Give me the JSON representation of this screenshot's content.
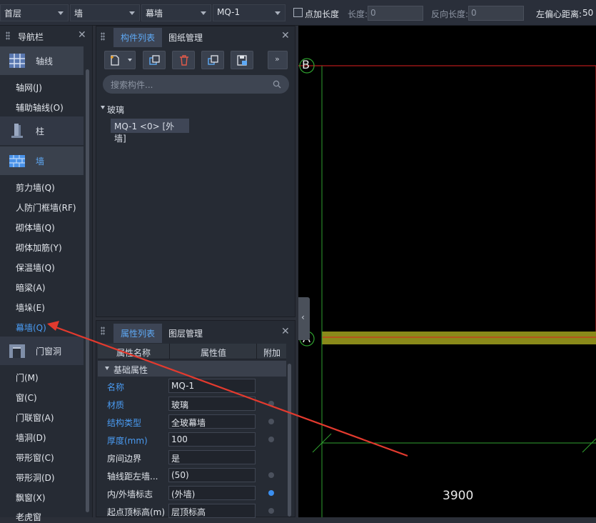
{
  "toolbar": {
    "floor": "首层",
    "category": "墙",
    "type": "幕墙",
    "component": "MQ-1",
    "add_point_length_label": "点加长度",
    "length_label": "长度:",
    "length_value": "0",
    "reverse_length_label": "反向长度:",
    "reverse_length_value": "0",
    "left_offset_label": "左偏心距离:",
    "left_offset_value": "50"
  },
  "nav": {
    "title": "导航栏",
    "categories": [
      {
        "label": "轴线",
        "icon": "grid-icon",
        "items": [
          "轴网(J)",
          "辅助轴线(O)"
        ]
      },
      {
        "label": "柱",
        "icon": "column-icon",
        "items": []
      },
      {
        "label": "墙",
        "icon": "wall-icon",
        "items": [
          "剪力墙(Q)",
          "人防门框墙(RF)",
          "砌体墙(Q)",
          "砌体加筋(Y)",
          "保温墙(Q)",
          "暗梁(A)",
          "墙垛(E)",
          "幕墙(Q)"
        ]
      },
      {
        "label": "门窗洞",
        "icon": "door-window-icon",
        "items": [
          "门(M)",
          "窗(C)",
          "门联窗(A)",
          "墙洞(D)",
          "带形窗(C)",
          "带形洞(D)",
          "飘窗(X)",
          "老虎窗"
        ]
      }
    ]
  },
  "component_panel": {
    "tabs": [
      "构件列表",
      "图纸管理"
    ],
    "search_placeholder": "搜索构件...",
    "tree_group": "玻璃",
    "tree_item": "MQ-1 <0> [外墙]"
  },
  "property_panel": {
    "tabs": [
      "属性列表",
      "图层管理"
    ],
    "columns": [
      "属性名称",
      "属性值",
      "附加"
    ],
    "group": "基础属性",
    "rows": [
      {
        "name": "名称",
        "value": "MQ-1",
        "blue": true,
        "dot": ""
      },
      {
        "name": "材质",
        "value": "玻璃",
        "blue": true,
        "dot": "gray"
      },
      {
        "name": "结构类型",
        "value": "全玻幕墙",
        "blue": true,
        "dot": "gray"
      },
      {
        "name": "厚度(mm)",
        "value": "100",
        "blue": true,
        "dot": "gray"
      },
      {
        "name": "房间边界",
        "value": "是",
        "blue": false,
        "dot": ""
      },
      {
        "name": "轴线距左墙...",
        "value": "(50)",
        "blue": false,
        "dot": "gray"
      },
      {
        "name": "内/外墙标志",
        "value": "(外墙)",
        "blue": false,
        "dot": "blue"
      },
      {
        "name": "起点顶标高(m)",
        "value": "层顶标高",
        "blue": false,
        "dot": "gray"
      }
    ]
  },
  "canvas": {
    "axis_top": "B",
    "axis_bottom": "A",
    "dimension": "3900"
  },
  "colors": {
    "accent": "#3b8ff0",
    "active_tab": "#5ea9f5",
    "wall_fill": "#8a8a1a",
    "axis_green": "#2fa12f",
    "wall_red": "#e02020",
    "arrow_red": "#e33a2e"
  }
}
